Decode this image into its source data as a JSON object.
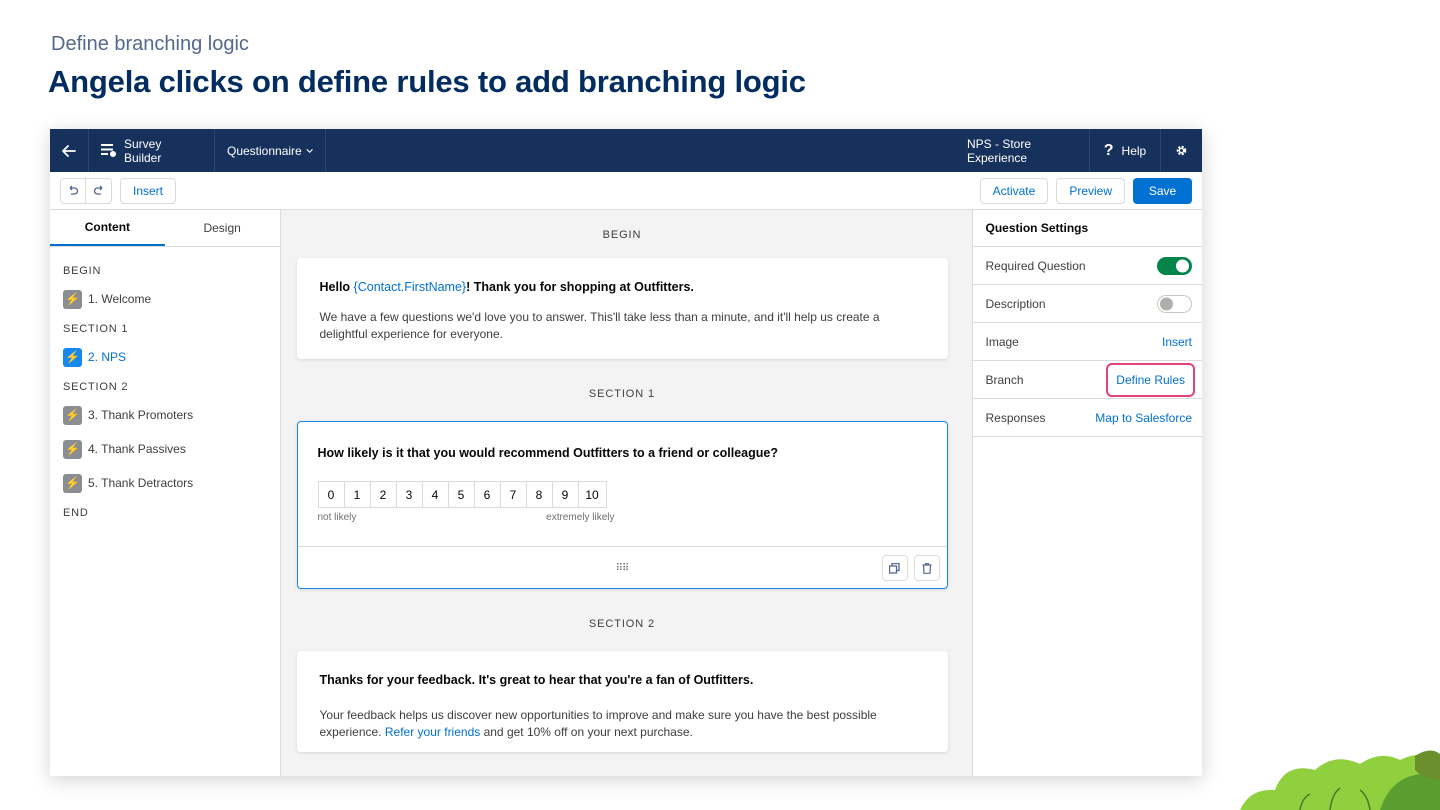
{
  "slide": {
    "subtitle": "Define branching logic",
    "title": "Angela clicks on define rules to add branching logic"
  },
  "topbar": {
    "back_icon": "arrow-left-icon",
    "app_icon": "survey-builder-icon",
    "app_name": "Survey Builder",
    "menu_label": "Questionnaire",
    "survey_name": "NPS - Store Experience",
    "help_label": "Help",
    "settings_icon": "gear-icon"
  },
  "toolbar": {
    "undo_icon": "undo-icon",
    "redo_icon": "redo-icon",
    "insert_label": "Insert",
    "activate_label": "Activate",
    "preview_label": "Preview",
    "save_label": "Save"
  },
  "left_panel": {
    "tabs": [
      "Content",
      "Design"
    ],
    "outline": {
      "begin": "BEGIN",
      "item_welcome": "1. Welcome",
      "section1": "SECTION 1",
      "item_nps": "2. NPS",
      "section2": "SECTION 2",
      "item_promoters": "3. Thank Promoters",
      "item_passives": "4. Thank Passives",
      "item_detractors": "5. Thank Detractors",
      "end": "END"
    }
  },
  "canvas": {
    "begin_label": "BEGIN",
    "welcome": {
      "greeting": "Hello ",
      "merge_field": "{Contact.FirstName}",
      "greeting_rest": "!  Thank you for shopping at Outfitters.",
      "body": "We have a few questions we'd love you to answer. This'll take less than a minute, and it'll help us create a delightful experience for everyone."
    },
    "section1_label": "SECTION 1",
    "question": {
      "title": "How likely is it that you would recommend Outfitters to a friend or colleague?",
      "scale": [
        "0",
        "1",
        "2",
        "3",
        "4",
        "5",
        "6",
        "7",
        "8",
        "9",
        "10"
      ],
      "low_label": "not likely",
      "high_label": "extremely likely",
      "drag_icon": "drag-handle-icon",
      "copy_icon": "copy-icon",
      "delete_icon": "trash-icon"
    },
    "section2_label": "SECTION 2",
    "thanks": {
      "heading": "Thanks for your feedback. It's great to hear that you're a fan of Outfitters.",
      "body_start": "Your feedback helps us discover new opportunities to improve and make sure you have the best possible experience. ",
      "link": "Refer your friends",
      "body_end": " and get 10% off on your next purchase."
    }
  },
  "settings": {
    "title": "Question Settings",
    "required_label": "Required Question",
    "required_on": true,
    "description_label": "Description",
    "description_on": false,
    "image_label": "Image",
    "image_action": "Insert",
    "branch_label": "Branch",
    "branch_action": "Define Rules",
    "responses_label": "Responses",
    "responses_action": "Map to Salesforce"
  },
  "colors": {
    "nav": "#16325c",
    "brand": "#0070d2",
    "highlight": "#e2437c",
    "toggle_on": "#04844b",
    "title": "#032d60"
  }
}
